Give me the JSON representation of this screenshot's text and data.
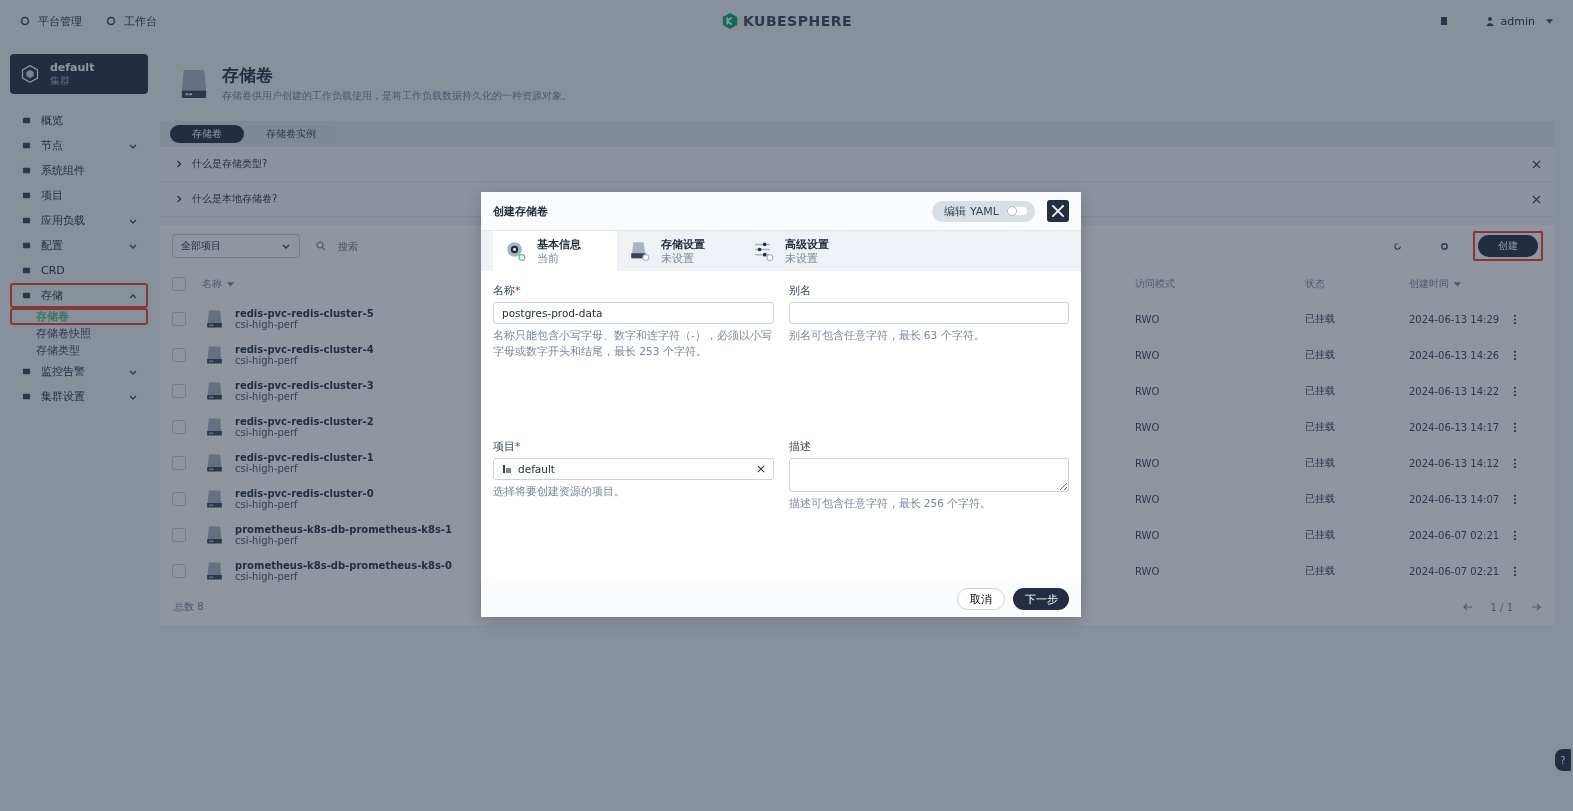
{
  "top_bar": {
    "nav": [
      "平台管理",
      "工作台"
    ],
    "logo": "KUBESPHERE",
    "user": "admin"
  },
  "cluster": {
    "name": "default",
    "subtitle": "集群"
  },
  "sidebar": {
    "items": [
      {
        "label": "概览",
        "expandable": false,
        "highlighted": false
      },
      {
        "label": "节点",
        "expandable": true,
        "expanded": false,
        "highlighted": false
      },
      {
        "label": "系统组件",
        "expandable": false,
        "highlighted": false
      },
      {
        "label": "项目",
        "expandable": false,
        "highlighted": false
      },
      {
        "label": "应用负载",
        "expandable": true,
        "expanded": false,
        "highlighted": false
      },
      {
        "label": "配置",
        "expandable": true,
        "expanded": false,
        "highlighted": false
      },
      {
        "label": "CRD",
        "expandable": false,
        "highlighted": false
      },
      {
        "label": "存储",
        "expandable": true,
        "expanded": true,
        "highlighted": true,
        "children": [
          {
            "label": "存储卷",
            "selected": true,
            "highlighted": true
          },
          {
            "label": "存储卷快照",
            "selected": false,
            "highlighted": false
          },
          {
            "label": "存储类型",
            "selected": false,
            "highlighted": false
          }
        ]
      },
      {
        "label": "监控告警",
        "expandable": true,
        "expanded": false,
        "highlighted": false
      },
      {
        "label": "集群设置",
        "expandable": true,
        "expanded": false,
        "highlighted": false
      }
    ]
  },
  "header": {
    "title": "存储卷",
    "description": "存储卷供用户创建的工作负载使用，是将工作负载数据持久化的一种资源对象。"
  },
  "tabs": [
    {
      "label": "存储卷",
      "selected": true
    },
    {
      "label": "存储卷实例",
      "selected": false
    }
  ],
  "banners": [
    "什么是存储类型?",
    "什么是本地存储卷?"
  ],
  "toolbar": {
    "project_select": "全部项目",
    "search_placeholder": "搜索",
    "create": "创建",
    "create_highlighted": true
  },
  "table": {
    "columns": [
      "名称",
      "访问模式",
      "状态",
      "创建时间"
    ],
    "all_checked": false,
    "rows": [
      {
        "name": "redis-pvc-redis-cluster-5",
        "class": "csi-high-perf",
        "access": "RWO",
        "status": "已挂载",
        "created": "2024-06-13 14:29",
        "checked": false
      },
      {
        "name": "redis-pvc-redis-cluster-4",
        "class": "csi-high-perf",
        "access": "RWO",
        "status": "已挂载",
        "created": "2024-06-13 14:26",
        "checked": false
      },
      {
        "name": "redis-pvc-redis-cluster-3",
        "class": "csi-high-perf",
        "access": "RWO",
        "status": "已挂载",
        "created": "2024-06-13 14:22",
        "checked": false
      },
      {
        "name": "redis-pvc-redis-cluster-2",
        "class": "csi-high-perf",
        "access": "RWO",
        "status": "已挂载",
        "created": "2024-06-13 14:17",
        "checked": false
      },
      {
        "name": "redis-pvc-redis-cluster-1",
        "class": "csi-high-perf",
        "access": "RWO",
        "status": "已挂载",
        "created": "2024-06-13 14:12",
        "checked": false
      },
      {
        "name": "redis-pvc-redis-cluster-0",
        "class": "csi-high-perf",
        "access": "RWO",
        "status": "已挂载",
        "created": "2024-06-13 14:07",
        "checked": false
      },
      {
        "name": "prometheus-k8s-db-prometheus-k8s-1",
        "class": "csi-high-perf",
        "access": "RWO",
        "status": "已挂载",
        "created": "2024-06-07 02:21",
        "checked": false
      },
      {
        "name": "prometheus-k8s-db-prometheus-k8s-0",
        "class": "csi-high-perf",
        "access": "RWO",
        "status": "已挂载",
        "created": "2024-06-07 02:21",
        "checked": false
      }
    ],
    "total_label": "总数",
    "total": "8",
    "pages": "1 / 1"
  },
  "help": "?",
  "modal": {
    "title": "创建存储卷",
    "yaml_label": "编辑 YAML",
    "yaml_on": false,
    "steps": [
      {
        "title": "基本信息",
        "status": "当前",
        "selected": true
      },
      {
        "title": "存储设置",
        "status": "未设置",
        "selected": false
      },
      {
        "title": "高级设置",
        "status": "未设置",
        "selected": false
      }
    ],
    "fields": [
      {
        "label": "名称",
        "required_mark": "*",
        "kind": "input",
        "value": "postgres-prod-data",
        "hint": "名称只能包含小写字母、数字和连字符（-），必须以小写字母或数字开头和结尾，最长 253 个字符。"
      },
      {
        "label": "别名",
        "kind": "input",
        "hint": "别名可包含任意字符，最长 63 个字符。"
      },
      {
        "label": "项目",
        "required_mark": "*",
        "kind": "select",
        "value": "default",
        "hint": "选择将要创建资源的项目。"
      },
      {
        "label": "描述",
        "kind": "textarea",
        "hint": "描述可包含任意字符，最长 256 个字符。"
      }
    ],
    "cancel": "取消",
    "next": "下一步"
  }
}
